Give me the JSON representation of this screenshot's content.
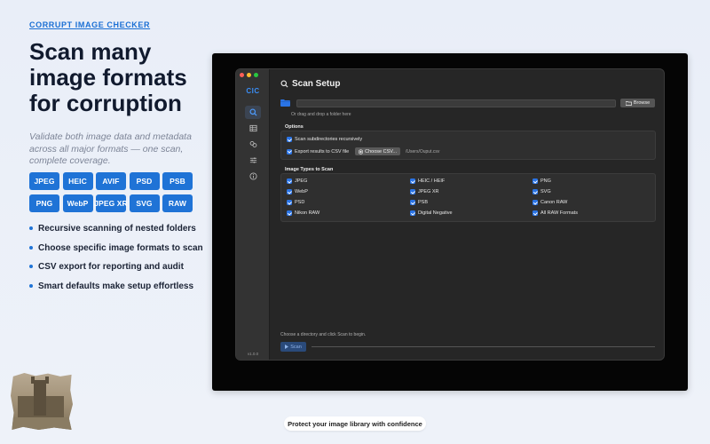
{
  "marketing": {
    "eyebrow": "CORRUPT IMAGE CHECKER",
    "headline": "Scan many image formats for corruption",
    "subtext": "Validate both image data and metadata across all major formats — one scan, complete coverage.",
    "formats": [
      "JPEG",
      "HEIC",
      "AVIF",
      "PSD",
      "PSB",
      "PNG",
      "WebP",
      "JPEG XR",
      "SVG",
      "RAW"
    ],
    "features": [
      "Recursive scanning of nested folders",
      "Choose specific image formats to scan",
      "CSV export for reporting and audit",
      "Smart defaults make setup effortless"
    ],
    "footer": "Protect your image library with confidence"
  },
  "app": {
    "logo": "CIC",
    "version": "v1.0.0",
    "sidebar_icons": [
      "search-icon",
      "table-icon",
      "link-icon",
      "sliders-icon",
      "info-icon"
    ],
    "title": "Scan Setup",
    "folder": {
      "path_value": "",
      "browse_label": "Browse",
      "hint": "Or drag and drop a folder here"
    },
    "options": {
      "label": "Options",
      "recursive_label": "Scan subdirectories recursively",
      "recursive_checked": true,
      "export_label": "Export results to CSV file",
      "export_checked": true,
      "choose_csv_label": "Choose CSV...",
      "csv_path": "/Users/Ouput.csv"
    },
    "types": {
      "label": "Image Types to Scan",
      "items": [
        {
          "label": "JPEG",
          "checked": true
        },
        {
          "label": "HEIC / HEIF",
          "checked": true
        },
        {
          "label": "PNG",
          "checked": true
        },
        {
          "label": "WebP",
          "checked": true
        },
        {
          "label": "JPEG XR",
          "checked": true
        },
        {
          "label": "SVG",
          "checked": true
        },
        {
          "label": "PSD",
          "checked": true
        },
        {
          "label": "PSB",
          "checked": true
        },
        {
          "label": "Canon RAW",
          "checked": true
        },
        {
          "label": "Nikon RAW",
          "checked": true
        },
        {
          "label": "Digital Negative",
          "checked": true
        },
        {
          "label": "All RAW Formats",
          "checked": true
        }
      ]
    },
    "status": "Choose a directory and click Scan to begin.",
    "scan_label": "Scan",
    "progress": 0,
    "colors": {
      "accent": "#2a74e6",
      "brand_blue": "#1f73d6",
      "window_bg": "#262626",
      "sidebar_bg": "#333333"
    }
  }
}
